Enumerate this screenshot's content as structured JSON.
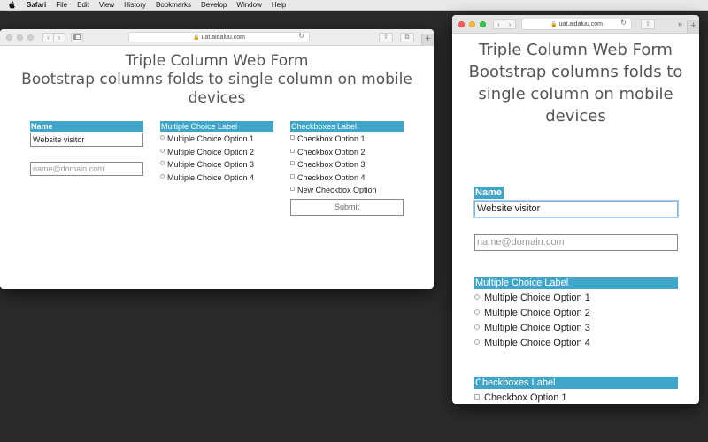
{
  "menubar": {
    "app": "Safari",
    "items": [
      "File",
      "Edit",
      "View",
      "History",
      "Bookmarks",
      "Develop",
      "Window",
      "Help"
    ]
  },
  "browser": {
    "url": "uat.aidaluu.com"
  },
  "form": {
    "title_line1": "Triple Column Web Form",
    "title_line2": "Bootstrap columns folds to single column on mobile devices",
    "title_mobile": "Triple Column Web Form Bootstrap columns folds to single column on mobile devices",
    "name_label": "Name",
    "name_value": "Website visitor",
    "email_placeholder": "name@domain.com",
    "mc_label": "Multiple Choice Label",
    "mc_options": [
      "Multiple Choice Option 1",
      "Multiple Choice Option 2",
      "Multiple Choice Option 3",
      "Multiple Choice Option 4"
    ],
    "cb_label": "Checkboxes Label",
    "cb_options": [
      "Checkbox Option 1",
      "Checkbox Option 2",
      "Checkbox Option 3",
      "Checkbox Option 4",
      "New Checkbox Option"
    ],
    "submit_label": "Submit"
  }
}
